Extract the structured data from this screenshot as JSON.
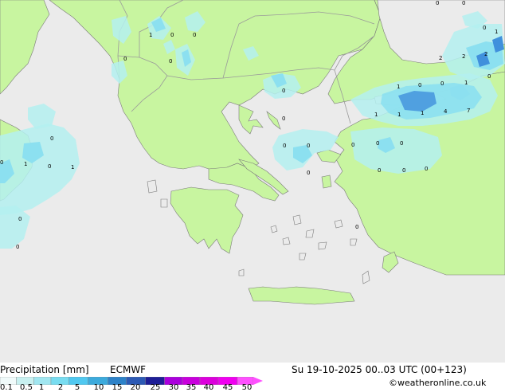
{
  "title": "Precipitation [mm]",
  "model": "ECMWF",
  "valid_time": "Su 19-10-2025 00..03 UTC (00+123)",
  "copyright": "©weatheronline.co.uk",
  "legend": {
    "ticks": [
      "0.1",
      "0.5",
      "1",
      "2",
      "5",
      "10",
      "15",
      "20",
      "25",
      "30",
      "35",
      "40",
      "45",
      "50"
    ],
    "colors": [
      "#f0fafa",
      "#c8f0f0",
      "#a0e6f0",
      "#78dcf0",
      "#50c8f0",
      "#3caadc",
      "#2d82c8",
      "#2d5ab4",
      "#1e1e96",
      "#aa00dc",
      "#c800dc",
      "#dc00dc",
      "#f000f0",
      "#ff50ff"
    ]
  },
  "colors": {
    "sea": "#ebebeb",
    "land": "#c8f5a0",
    "border": "#9a9a9a",
    "coast": "#7a7a7a",
    "precip_light": "#b4f0f0",
    "precip_mid": "#8ce0f0",
    "precip_heavy": "#4090dc"
  },
  "map_labels": [
    {
      "id": "l1",
      "text": "1"
    },
    {
      "id": "l2",
      "text": "0"
    },
    {
      "id": "l3",
      "text": "0"
    },
    {
      "id": "l4",
      "text": "0"
    },
    {
      "id": "l5",
      "text": "0"
    },
    {
      "id": "l6",
      "text": "0"
    },
    {
      "id": "l7",
      "text": "0"
    },
    {
      "id": "l8",
      "text": "0"
    },
    {
      "id": "l9",
      "text": "0"
    },
    {
      "id": "l10",
      "text": "0"
    },
    {
      "id": "l11",
      "text": "0"
    },
    {
      "id": "l12",
      "text": "0"
    },
    {
      "id": "l13",
      "text": "0"
    },
    {
      "id": "l14",
      "text": "0"
    },
    {
      "id": "l15",
      "text": "0"
    },
    {
      "id": "l16",
      "text": "0"
    },
    {
      "id": "l17",
      "text": "0"
    },
    {
      "id": "l18",
      "text": "0"
    },
    {
      "id": "l19",
      "text": "0"
    },
    {
      "id": "l20",
      "text": "0"
    },
    {
      "id": "l21",
      "text": "0"
    },
    {
      "id": "l22",
      "text": "0"
    },
    {
      "id": "l23",
      "text": "0"
    },
    {
      "id": "l24",
      "text": "0"
    },
    {
      "id": "l25",
      "text": "0"
    },
    {
      "id": "l26",
      "text": "0"
    },
    {
      "id": "l27",
      "text": "1"
    },
    {
      "id": "l28",
      "text": "2"
    },
    {
      "id": "l29",
      "text": "2"
    },
    {
      "id": "l30",
      "text": "2"
    },
    {
      "id": "l31",
      "text": "0"
    },
    {
      "id": "l32",
      "text": "1"
    },
    {
      "id": "l33",
      "text": "1"
    },
    {
      "id": "l34",
      "text": "0"
    },
    {
      "id": "l35",
      "text": "1"
    },
    {
      "id": "l36",
      "text": "1"
    },
    {
      "id": "l37",
      "text": "1"
    },
    {
      "id": "l38",
      "text": "4"
    },
    {
      "id": "l39",
      "text": "7"
    },
    {
      "id": "l40",
      "text": "1"
    },
    {
      "id": "l41",
      "text": "1"
    },
    {
      "id": "l42",
      "text": "0"
    },
    {
      "id": "l43",
      "text": "0"
    },
    {
      "id": "l44",
      "text": "0"
    },
    {
      "id": "l45",
      "text": "0"
    },
    {
      "id": "l46",
      "text": "1"
    },
    {
      "id": "l47",
      "text": "0"
    },
    {
      "id": "l48",
      "text": "0"
    },
    {
      "id": "l49",
      "text": "0"
    },
    {
      "id": "l50",
      "text": "0"
    }
  ]
}
